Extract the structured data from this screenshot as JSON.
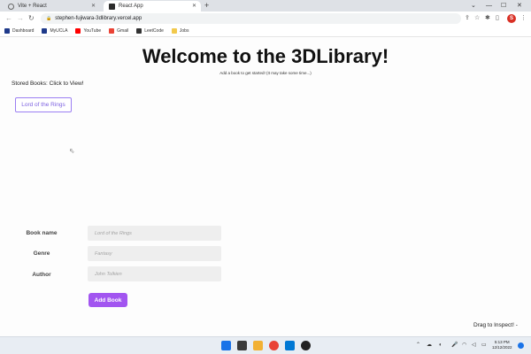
{
  "browser": {
    "tabs": [
      {
        "label": "Vite + React",
        "active": false
      },
      {
        "label": "React App",
        "active": true
      }
    ],
    "new_tab": "+",
    "address": "stephen-fujiwara-3dlibrary.vercel.app",
    "profile_initial": "S",
    "bookmarks": [
      {
        "label": "Dashboard",
        "icon": "dashboard-icon",
        "color": "#1f3a8a"
      },
      {
        "label": "MyUCLA",
        "icon": "myucla-icon",
        "color": "#1f3a8a"
      },
      {
        "label": "YouTube",
        "icon": "youtube-icon",
        "color": "#ff0000"
      },
      {
        "label": "Gmail",
        "icon": "gmail-icon",
        "color": "#ea4335"
      },
      {
        "label": "LeetCode",
        "icon": "leetcode-icon",
        "color": "#333333"
      },
      {
        "label": "Jobs",
        "icon": "folder-icon",
        "color": "#f2c94c"
      }
    ]
  },
  "page": {
    "title": "Welcome to the 3DLibrary!",
    "subtitle": "Add a book to get started! (It may take some time...)",
    "stored_label": "Stored Books: Click to View!",
    "stored_books": [
      "Lord of the Rings"
    ],
    "form": {
      "fields": [
        {
          "label": "Book name",
          "placeholder": "Lord of the Rings"
        },
        {
          "label": "Genre",
          "placeholder": "Fantasy"
        },
        {
          "label": "Author",
          "placeholder": "John Tolkien"
        }
      ],
      "submit_label": "Add Book"
    },
    "drag_hint": "Drag to Inspect! -"
  },
  "taskbar": {
    "time": "5:13 PM",
    "date": "12/12/2022"
  },
  "colors": {
    "accent": "#a255f0",
    "book_button_border": "#9b7ff2",
    "input_bg": "#eeeeee"
  }
}
